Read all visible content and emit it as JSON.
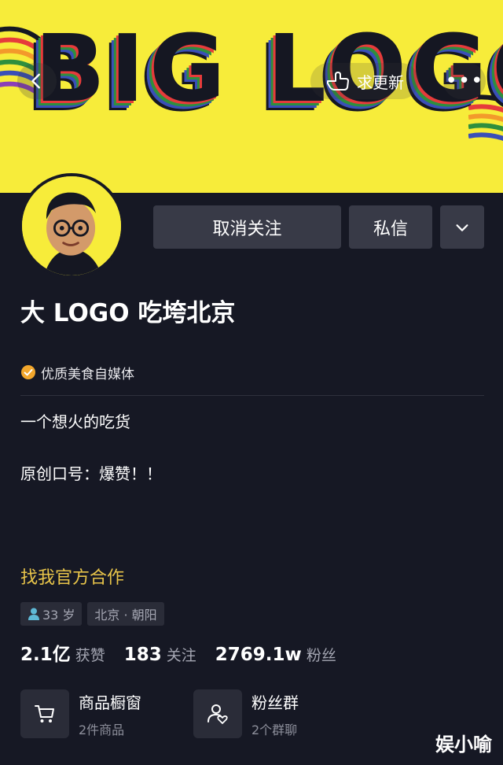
{
  "banner": {
    "logo_text": "BIG LOGO",
    "update_label": "求更新",
    "more_label": "•••"
  },
  "actions": {
    "unfollow": "取消关注",
    "message": "私信"
  },
  "profile": {
    "name": "大 LOGO 吃垮北京",
    "verification": "优质美食自媒体",
    "bio_line1": "一个想火的吃货",
    "bio_line2": "原创口号：爆赞！！",
    "cooperation": "找我官方合作",
    "age": "33 岁",
    "location": "北京 · 朝阳"
  },
  "stats": [
    {
      "value": "2.1亿",
      "label": "获赞"
    },
    {
      "value": "183",
      "label": "关注"
    },
    {
      "value": "2769.1w",
      "label": "粉丝"
    }
  ],
  "cards": {
    "shop_title": "商品橱窗",
    "shop_sub": "2件商品",
    "group_title": "粉丝群",
    "group_sub": "2个群聊"
  },
  "watermark": "娱小喻",
  "colors": {
    "background": "#161824",
    "banner_yellow": "#f7ec3a",
    "button_bg": "#383a47",
    "accent_gold": "#e9c54a",
    "muted_text": "#a4a6b2"
  },
  "icons": [
    "back-arrow-icon",
    "hand-pointer-icon",
    "more-dots-icon",
    "chevron-down-icon",
    "verified-badge-icon",
    "person-icon",
    "cart-icon",
    "group-chat-icon"
  ]
}
